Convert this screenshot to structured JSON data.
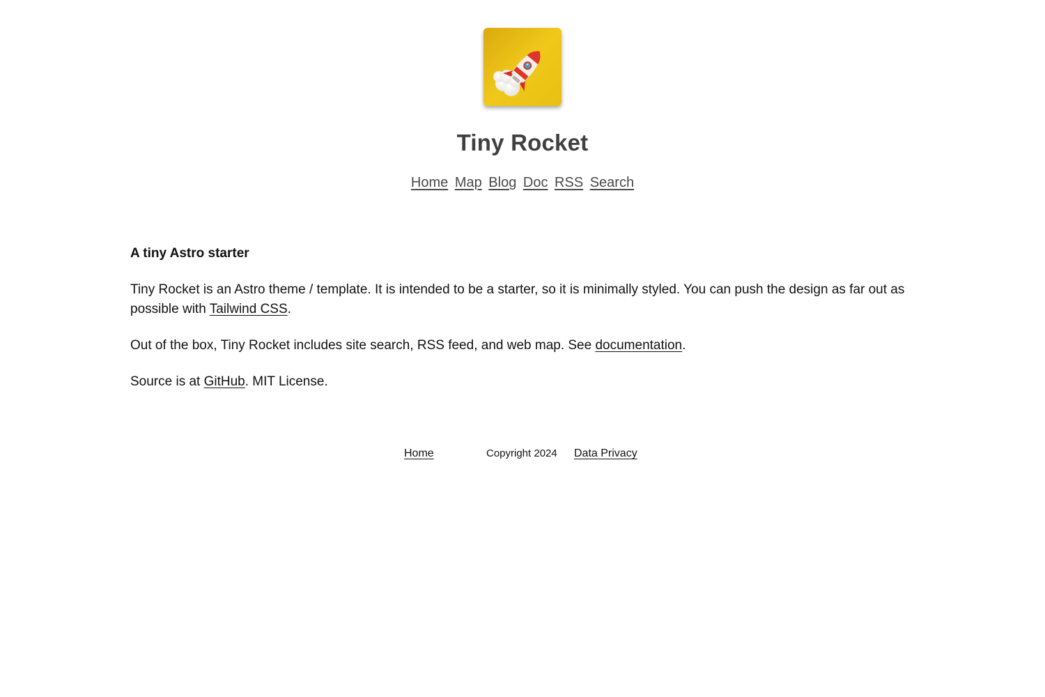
{
  "site": {
    "title": "Tiny Rocket",
    "logo_icon": "rocket-icon"
  },
  "nav": {
    "items": [
      {
        "label": "Home"
      },
      {
        "label": "Map"
      },
      {
        "label": "Blog"
      },
      {
        "label": "Doc"
      },
      {
        "label": "RSS"
      },
      {
        "label": "Search"
      }
    ]
  },
  "main": {
    "heading": "A tiny Astro starter",
    "p1_text": "Tiny Rocket is an Astro theme / template. It is intended to be a starter, so it is minimally styled. You can push the design as far out as possible with ",
    "p1_link": "Tailwind CSS",
    "p1_end": ".",
    "p2_text": "Out of the box, Tiny Rocket includes site search, RSS feed, and web map. See ",
    "p2_link": "documentation",
    "p2_end": ".",
    "p3_text": "Source is at ",
    "p3_link": "GitHub",
    "p3_end": ". MIT License."
  },
  "footer": {
    "home": "Home",
    "copyright": "Copyright 2024",
    "privacy": "Data Privacy"
  },
  "colors": {
    "logo_bg": "#f1cb1a",
    "title": "#404040",
    "nav_link": "#4a4a4a",
    "rocket": "#e0352b"
  }
}
